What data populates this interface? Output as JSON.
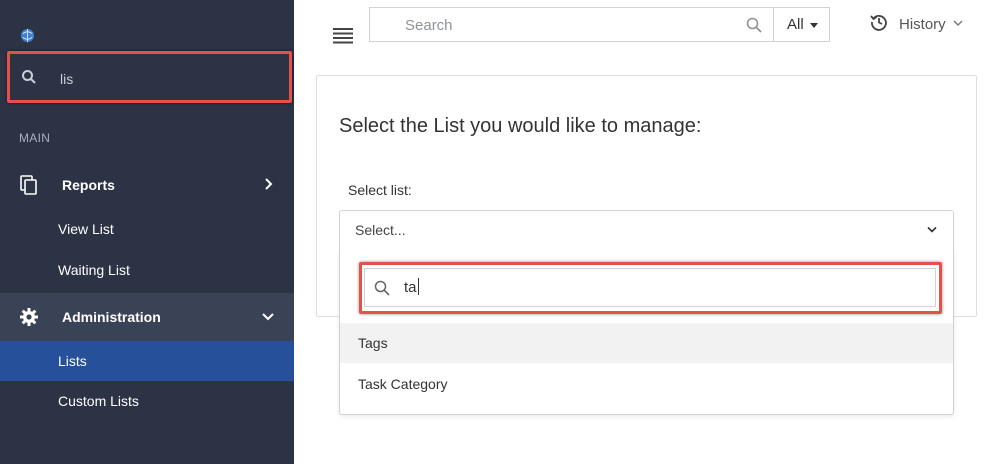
{
  "sidebar": {
    "search_value": "lis",
    "section_label": "MAIN",
    "reports": {
      "label": "Reports",
      "icon": "copy-icon"
    },
    "reports_items": [
      {
        "label": "View List"
      },
      {
        "label": "Waiting List"
      }
    ],
    "administration": {
      "label": "Administration",
      "icon": "gear-icon"
    },
    "administration_items": [
      {
        "label": "Lists",
        "active": true
      },
      {
        "label": "Custom Lists"
      }
    ]
  },
  "topbar": {
    "search_placeholder": "Search",
    "scope_label": "All",
    "history_label": "History"
  },
  "main": {
    "title": "Select the List you would like to manage:",
    "select_label": "Select list:",
    "select_placeholder": "Select...",
    "dropdown": {
      "search_value": "ta",
      "options": [
        {
          "label": "Tags",
          "highlighted": true
        },
        {
          "label": "Task Category"
        }
      ]
    }
  },
  "colors": {
    "sidebar_bg": "#2b3345",
    "sidebar_active": "#26519a",
    "sidebar_hover": "#3a4356",
    "highlight_frame": "#e2514a"
  }
}
